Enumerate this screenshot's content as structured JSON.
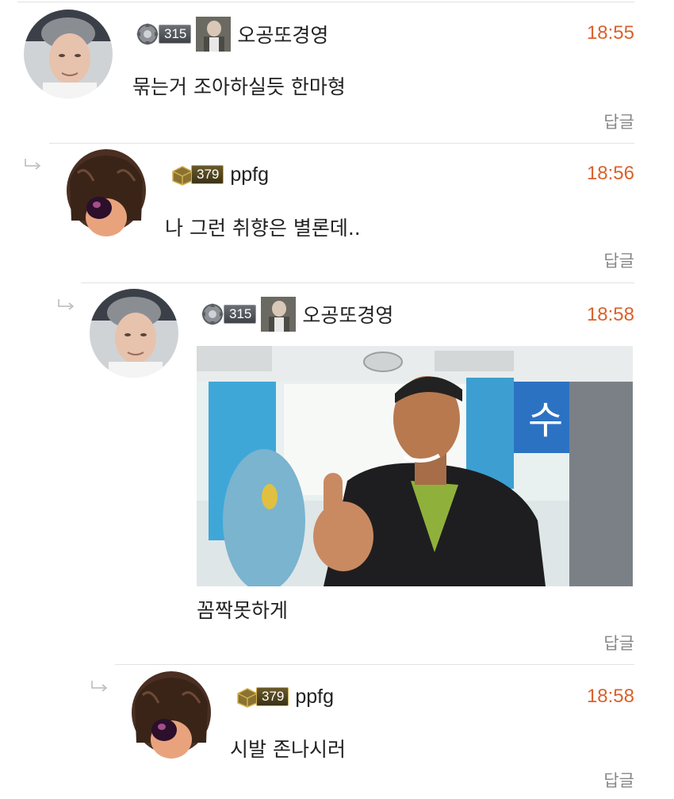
{
  "comments": [
    {
      "nickname": "오공또경영",
      "level": "315",
      "badge_type": "silver",
      "time": "18:55",
      "text": "묶는거 조아하실듯 한마형",
      "reply_label": "답글",
      "avatar": "old-man-avatar",
      "is_reply": false
    },
    {
      "nickname": "ppfg",
      "level": "379",
      "badge_type": "gold",
      "time": "18:56",
      "text": "나 그런 취향은 별론데..",
      "reply_label": "답글",
      "avatar": "hairy-creature-avatar",
      "is_reply": true
    },
    {
      "nickname": "오공또경영",
      "level": "315",
      "badge_type": "silver",
      "time": "18:58",
      "text": "꼼짝못하게",
      "reply_label": "답글",
      "avatar": "old-man-avatar",
      "image": "man-giving-thumbs-up-on-bus-photo",
      "is_reply": true
    },
    {
      "nickname": "ppfg",
      "level": "379",
      "badge_type": "gold",
      "time": "18:58",
      "text": "시발 존나시러",
      "reply_label": "답글",
      "avatar": "hairy-creature-avatar",
      "is_reply": true
    }
  ],
  "colors": {
    "time": "#d9622b",
    "reply_button": "#888888",
    "divider": "#e2e2e2",
    "text": "#222222",
    "gold_badge_border": "#d2b04c"
  }
}
